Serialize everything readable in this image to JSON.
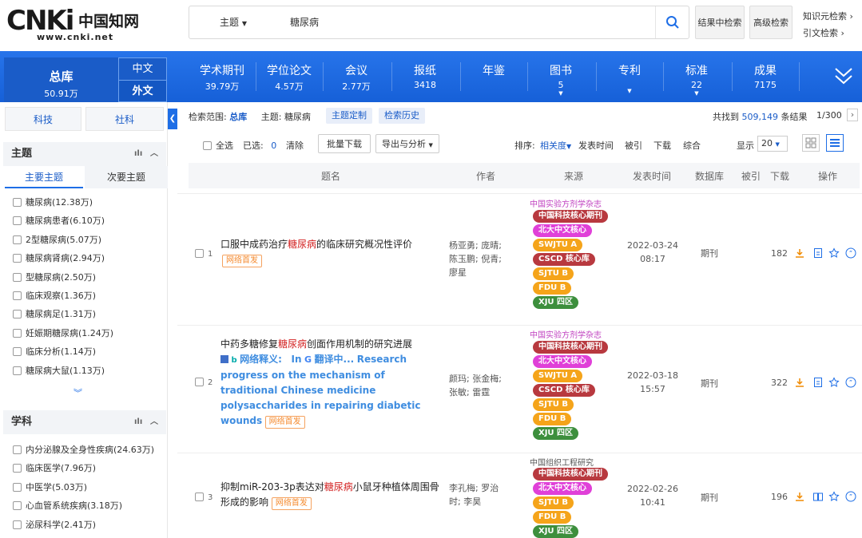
{
  "header": {
    "logo_text": "CNKi",
    "logo_cn": "中国知网",
    "logo_url": "www.cnki.net",
    "search_type": "主题",
    "search_value": "糖尿病",
    "btn_in_results": "结果中检索",
    "btn_advanced": "高级检索",
    "link_knowledge": "知识元检索",
    "link_citation": "引文检索"
  },
  "nav": {
    "total": {
      "label": "总库",
      "count": "50.91万"
    },
    "lang_cn": "中文",
    "lang_en": "外文",
    "items": [
      {
        "label": "学术期刊",
        "count": "39.79万"
      },
      {
        "label": "学位论文",
        "count": "4.57万"
      },
      {
        "label": "会议",
        "count": "2.77万"
      },
      {
        "label": "报纸",
        "count": "3418"
      },
      {
        "label": "年鉴",
        "count": ""
      },
      {
        "label": "图书",
        "count": "5"
      },
      {
        "label": "专利",
        "count": ""
      },
      {
        "label": "标准",
        "count": "22"
      },
      {
        "label": "成果",
        "count": "7175"
      }
    ]
  },
  "sidebar": {
    "tab_sci": "科技",
    "tab_soc": "社科",
    "topic_title": "主题",
    "topic_main": "主要主题",
    "topic_sub": "次要主题",
    "topics": [
      "糖尿病(12.38万)",
      "糖尿病患者(6.10万)",
      "2型糖尿病(5.07万)",
      "糖尿病肾病(2.94万)",
      "型糖尿病(2.50万)",
      "临床观察(1.36万)",
      "糖尿病足(1.31万)",
      "妊娠期糖尿病(1.24万)",
      "临床分析(1.14万)",
      "糖尿病大鼠(1.13万)"
    ],
    "discipline_title": "学科",
    "disciplines": [
      "内分泌腺及全身性疾病(24.63万)",
      "临床医学(7.96万)",
      "中医学(5.03万)",
      "心血管系统疾病(3.18万)",
      "泌尿科学(2.41万)"
    ]
  },
  "main": {
    "scope_label": "检索范围:",
    "scope_value": "总库",
    "topic_label": "主题:",
    "topic_value": "糖尿病",
    "btn_custom": "主题定制",
    "btn_history": "检索历史",
    "found_prefix": "共找到",
    "found_count": "509,149",
    "found_suffix": "条结果",
    "page_info": "1/300",
    "select_all": "全选",
    "selected_label": "已选:",
    "selected_count": "0",
    "clear": "清除",
    "batch_download": "批量下载",
    "export": "导出与分析",
    "sort_label": "排序:",
    "sort_relevance": "相关度",
    "sort_date": "发表时间",
    "sort_cited": "被引",
    "sort_download": "下载",
    "sort_comprehensive": "综合",
    "display_label": "显示",
    "display_value": "20",
    "columns": [
      "题名",
      "作者",
      "来源",
      "发表时间",
      "数据库",
      "被引",
      "下载",
      "操作"
    ],
    "net_first": "网络首发",
    "results": [
      {
        "num": "1",
        "title_pre": "口服中成药治疗",
        "title_kw": "糖尿病",
        "title_post": "的临床研究概况性评价",
        "authors": "杨亚勇; 庞晴; 陈玉鹏; 倪青; 廖星",
        "source": "中国实验方剂学杂志",
        "date": "2022-03-24",
        "time": "08:17",
        "db": "期刊",
        "downloads": "182"
      },
      {
        "num": "2",
        "title_pre": "中药多糖修复",
        "title_kw": "糖尿病",
        "title_post": "创面作用机制的研究进展",
        "translate_label": "网络释义:",
        "translate_in": "In",
        "translate_mid": "翻译中...",
        "translate_text": "Research progress on the mechanism of traditional Chinese medicine polysaccharides in repairing diabetic wounds",
        "authors": "颜玛; 张金梅; 张敏; 雷霆",
        "source": "中国实验方剂学杂志",
        "date": "2022-03-18",
        "time": "15:57",
        "db": "期刊",
        "downloads": "322"
      },
      {
        "num": "3",
        "title_pre": "抑制miR-203-3p表达对",
        "title_kw": "糖尿病",
        "title_post": "小鼠牙种植体周围骨形成的影响",
        "authors": "李孔梅; 罗治时; 李昊",
        "source": "中国组织工程研究",
        "date": "2022-02-26",
        "time": "10:41",
        "db": "期刊",
        "downloads": "196"
      }
    ],
    "pills": {
      "core_journal": "中国科技核心期刊",
      "pku_core": "北大中文核心",
      "swjtu": "SWJTU A",
      "cscd": "CSCD 核心库",
      "sjtu": "SJTU B",
      "fdu": "FDU B",
      "xju": "XJU 四区"
    }
  },
  "colors": {
    "nav_blue": "#1e6ee6",
    "keyword_red": "#d32222",
    "pill_dark_red": "#b8393f",
    "pill_magenta": "#e040d8",
    "pill_orange": "#f5a41a",
    "pill_green": "#3d8f3d"
  }
}
